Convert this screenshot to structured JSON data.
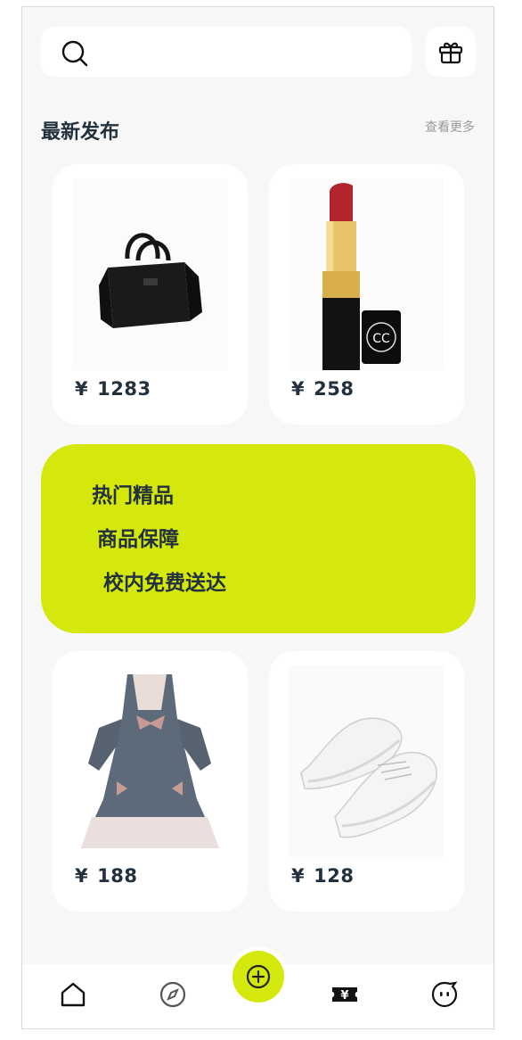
{
  "search": {
    "icon": "search-icon"
  },
  "header": {
    "gift_icon": "gift-icon"
  },
  "section": {
    "title": "最新发布",
    "more": "查看更多"
  },
  "products": [
    {
      "name": "handbag",
      "currency": "¥",
      "price": "1283"
    },
    {
      "name": "lipstick",
      "currency": "¥",
      "price": "258"
    },
    {
      "name": "dress",
      "currency": "¥",
      "price": "188"
    },
    {
      "name": "sneakers",
      "currency": "¥",
      "price": "128"
    }
  ],
  "banner": {
    "line1": "热门精品",
    "line2": "商品保障",
    "line3": "校内免费送达",
    "color": "#d4e80b"
  },
  "tabbar": {
    "items": [
      "home-icon",
      "compass-icon",
      "add-icon",
      "ticket-icon",
      "chat-face-icon"
    ]
  },
  "colors": {
    "accent": "#d4e80b",
    "background": "#f7f7f7",
    "text": "#23313f"
  }
}
